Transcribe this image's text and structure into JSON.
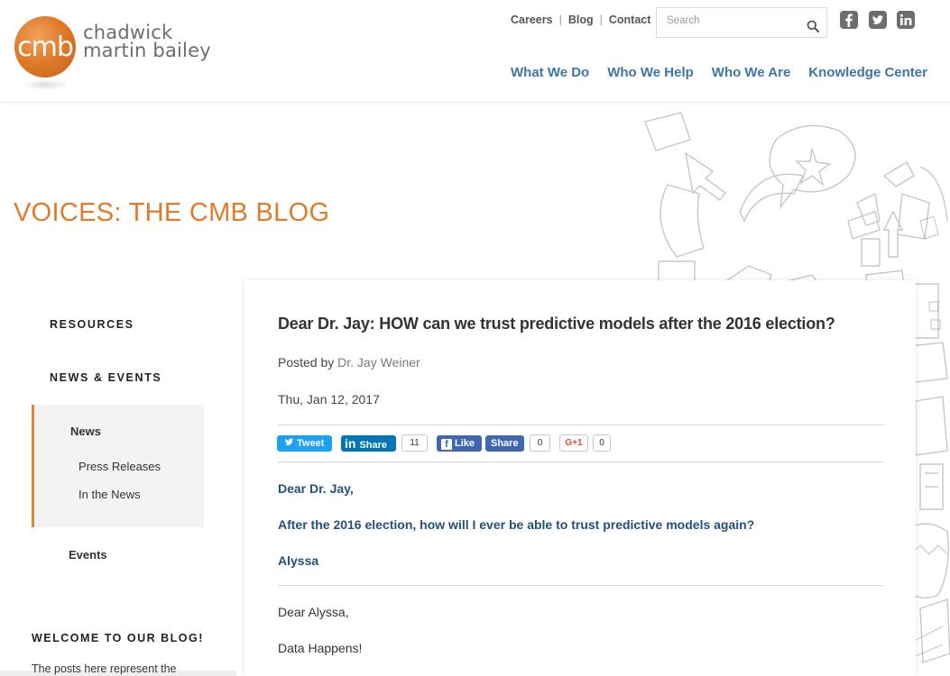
{
  "brand": {
    "logo_mark": "cmb",
    "logo_line1": "chadwick",
    "logo_line2": "martin bailey"
  },
  "utility_nav": {
    "careers": "Careers",
    "blog": "Blog",
    "contact": "Contact",
    "separator": "|"
  },
  "search": {
    "placeholder": "Search",
    "icon": "search-icon"
  },
  "social": {
    "icons": [
      "facebook-icon",
      "twitter-icon",
      "linkedin-icon"
    ],
    "color": "#6d6d6d"
  },
  "main_nav": {
    "items": [
      {
        "label": "What We Do"
      },
      {
        "label": "Who We Help"
      },
      {
        "label": "Who We Are"
      },
      {
        "label": "Knowledge Center"
      }
    ],
    "color": "#3d76a8"
  },
  "page": {
    "title": "VOICES: THE CMB BLOG",
    "title_color": "#e07b2a"
  },
  "sidebar": {
    "resources": "RESOURCES",
    "news_events": "NEWS & EVENTS",
    "news": "News",
    "press_releases": "Press Releases",
    "in_the_news": "In the News",
    "events": "Events",
    "welcome_heading": "WELCOME TO OUR BLOG!",
    "welcome_text": "The posts here represent the"
  },
  "article": {
    "title": "Dear Dr. Jay: HOW can we trust predictive models after the 2016 election?",
    "posted_by_label": "Posted by",
    "author": "Dr. Jay Weiner",
    "date": "Thu, Jan 12, 2017",
    "greeting": "Dear Dr. Jay,",
    "question": "After the 2016 election, how will I ever be able to trust predictive models again?",
    "signoff": "Alyssa",
    "reply_greeting": "Dear Alyssa,",
    "reply_line1": "Data Happens!"
  },
  "share_bar": {
    "tweet_label": "Tweet",
    "linkedin_label": "Share",
    "linkedin_count": "11",
    "fb_like_label": "Like",
    "fb_share_label": "Share",
    "fb_count": "0",
    "gplus_label": "G+1",
    "gplus_count": "0",
    "twitter_color": "#1da1f2",
    "linkedin_color": "#0077b5",
    "facebook_color": "#4267b2"
  }
}
